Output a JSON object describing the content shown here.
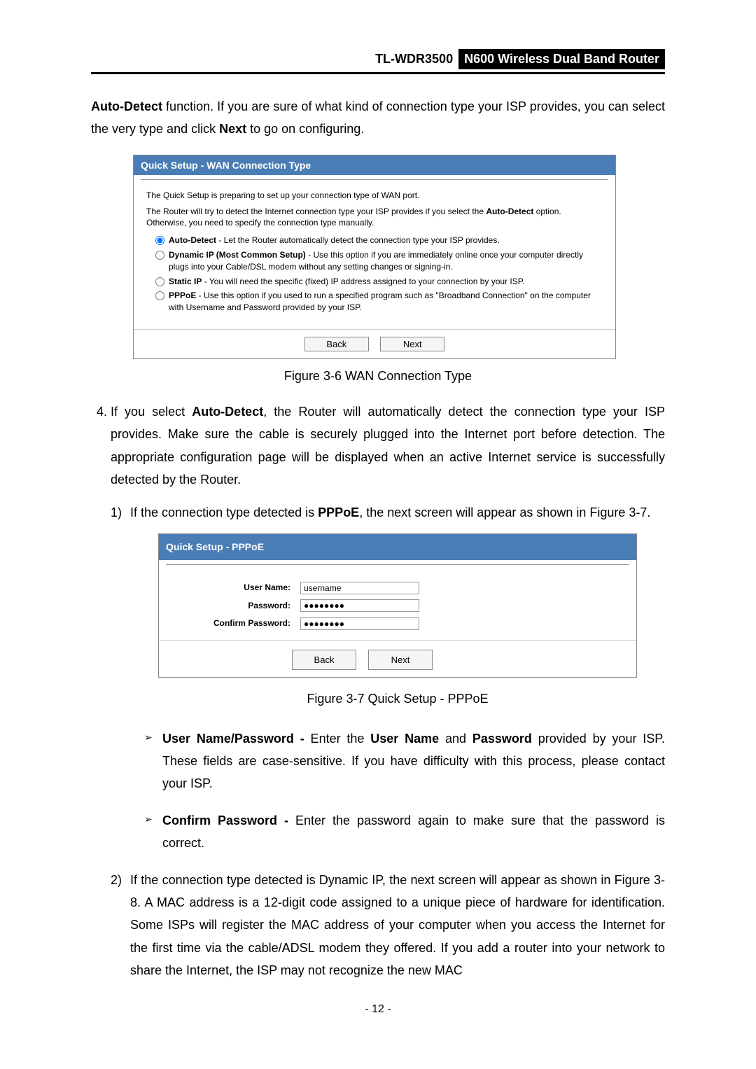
{
  "header": {
    "model": "TL-WDR3500",
    "product": "N600 Wireless Dual Band Router"
  },
  "intro": {
    "auto_detect_bold": "Auto-Detect",
    "intro_rest_a": " function. If you are sure of what kind of connection type your ISP provides, you can select the very type and click ",
    "next_bold": "Next",
    "intro_rest_b": " to go on configuring."
  },
  "shot1": {
    "title": "Quick Setup - WAN Connection Type",
    "line1": "The Quick Setup is preparing to set up your connection type of WAN port.",
    "line2a": "The Router will try to detect the Internet connection type your ISP provides if you select the ",
    "line2bold": "Auto-Detect",
    "line2b": " option. Otherwise, you need to specify the connection type manually.",
    "opt_auto_bold": "Auto-Detect",
    "opt_auto_rest": " - Let the Router automatically detect the connection type your ISP provides.",
    "opt_dynip_bold": "Dynamic IP (Most Common Setup)",
    "opt_dynip_rest": " - Use this option if you are immediately online once your computer directly plugs into your Cable/DSL modem without any setting changes or signing-in.",
    "opt_static_bold": "Static IP",
    "opt_static_rest": " - You will need the specific (fixed) IP address assigned to your connection by your ISP.",
    "opt_pppoe_bold": "PPPoE",
    "opt_pppoe_rest": " - Use this option if you used to run a specified program such as \"Broadband Connection\" on the computer with Username and Password provided by your ISP.",
    "btn_back": "Back",
    "btn_next": "Next",
    "caption": "Figure 3-6 WAN Connection Type"
  },
  "step4": {
    "num": "4.",
    "text_a": "If you select ",
    "auto_detect_bold": "Auto-Detect",
    "text_b": ", the Router will automatically detect the connection type your ISP provides. Make sure the cable is securely plugged into the Internet port before detection. The appropriate configuration page will be displayed when an active Internet service is successfully detected by the Router."
  },
  "sub1": {
    "num": "1)",
    "text_a": "If the connection type detected is ",
    "pppoe_bold": "PPPoE",
    "text_b": ", the next screen will appear as shown in Figure 3-7."
  },
  "shot2": {
    "title": "Quick Setup - PPPoE",
    "lbl_user": "User Name:",
    "val_user": "username",
    "lbl_pass": "Password:",
    "val_pass": "●●●●●●●●",
    "lbl_confirm": "Confirm Password:",
    "val_confirm": "●●●●●●●●",
    "btn_back": "Back",
    "btn_next": "Next",
    "caption": "Figure 3-7 Quick Setup - PPPoE"
  },
  "bullets": {
    "un_bold": "User Name/Password -",
    "un_text_a": " Enter the ",
    "un_text_user_bold": "User Name",
    "un_text_and": " and ",
    "un_text_pass_bold": "Password",
    "un_text_b": " provided by your ISP. These fields are case-sensitive. If you have difficulty with this process, please contact your ISP.",
    "cp_bold": "Confirm Password -",
    "cp_text": " Enter the password again to make sure that the password is correct."
  },
  "sub2": {
    "num": "2)",
    "text": "If the connection type detected is Dynamic IP, the next screen will appear as shown in Figure 3-8. A MAC address is a 12-digit code assigned to a unique piece of hardware for identification. Some ISPs will register the MAC address of your computer when you access the Internet for the first time via the cable/ADSL modem they offered. If you add a router into your network to share the Internet, the ISP may not recognize the new MAC"
  },
  "page_number": "- 12 -"
}
